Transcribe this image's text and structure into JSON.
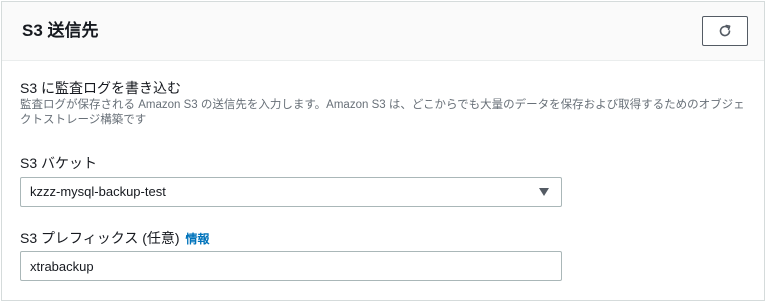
{
  "panel": {
    "title": "S3 送信先",
    "refresh_icon": "refresh-icon"
  },
  "section": {
    "title": "S3 に監査ログを書き込む",
    "description": "監査ログが保存される Amazon S3 の送信先を入力します。Amazon S3 は、どこからでも大量のデータを保存および取得するためのオブジェクトストレージ構築です"
  },
  "bucket": {
    "label": "S3 バケット",
    "selected_value": "kzzz-mysql-backup-test",
    "dropdown_icon": "caret-down-icon"
  },
  "prefix": {
    "label": "S3 プレフィックス (任意)",
    "info_link": "情報",
    "value": "xtrabackup"
  },
  "colors": {
    "link": "#0073bb",
    "border": "#aab7b8",
    "text": "#16191f",
    "muted_text": "#687078"
  }
}
